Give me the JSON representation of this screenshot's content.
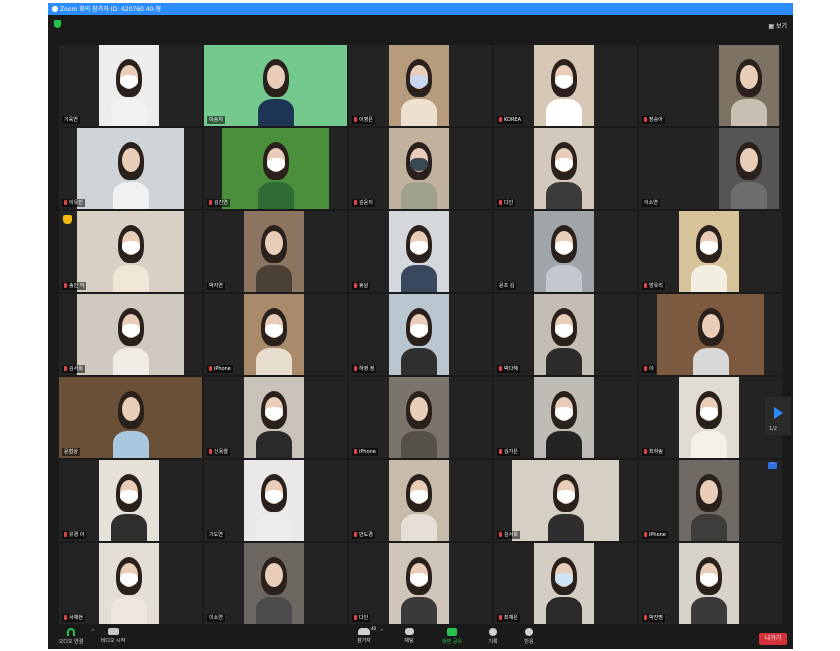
{
  "window": {
    "title": "Zoom 회의 참가자 ID: 420760   40-형",
    "view_label": "보기"
  },
  "pager": {
    "page": "1/2"
  },
  "participants": [
    {
      "name": "기육연",
      "muted": false,
      "bg": "#ededed",
      "shirt": "#f2f2f2",
      "mask": "#ffffff",
      "hand": false
    },
    {
      "name": "이승지",
      "muted": false,
      "bg": "#74c98e",
      "shirt": "#1e3556",
      "mask": "",
      "hand": false
    },
    {
      "name": "이영은",
      "muted": true,
      "bg": "#b69b7c",
      "shirt": "#ece0d0",
      "mask": "#c8d6ef",
      "hand": false
    },
    {
      "name": "KOREA",
      "muted": true,
      "bg": "#d6c8b5",
      "shirt": "#ffffff",
      "mask": "#ffffff",
      "hand": false
    },
    {
      "name": "장승아",
      "muted": true,
      "bg": "#7d7264",
      "shirt": "#c9c0b3",
      "mask": "",
      "hand": false
    },
    {
      "name": "이유진",
      "muted": true,
      "bg": "#cfd4d8",
      "shirt": "#f1f1f1",
      "mask": "",
      "hand": false
    },
    {
      "name": "김진연",
      "muted": true,
      "bg": "#4a8f3c",
      "shirt": "#2e6b35",
      "mask": "#ffffff",
      "hand": false
    },
    {
      "name": "김윤지",
      "muted": true,
      "bg": "#c0b29d",
      "shirt": "#a0a08f",
      "mask": "#3a4a55",
      "hand": false
    },
    {
      "name": "다인",
      "muted": true,
      "bg": "#d2c8bb",
      "shirt": "#3b3b3b",
      "mask": "#ffffff",
      "hand": false
    },
    {
      "name": "이소연",
      "muted": false,
      "bg": "#555555",
      "shirt": "#6d6d6d",
      "mask": "",
      "hand": false
    },
    {
      "name": "송인 악",
      "muted": true,
      "bg": "#d8d0c4",
      "shirt": "#efe6d6",
      "mask": "#ffffff",
      "hand": true
    },
    {
      "name": "박지연",
      "muted": false,
      "bg": "#8c7560",
      "shirt": "#4a4036",
      "mask": "",
      "hand": false
    },
    {
      "name": "휴날",
      "muted": true,
      "bg": "#d4d8dc",
      "shirt": "#39485e",
      "mask": "#ffffff",
      "hand": false
    },
    {
      "name": "윤조 김",
      "muted": false,
      "bg": "#9fa5a9",
      "shirt": "#c3c8ce",
      "mask": "#ffffff",
      "hand": false
    },
    {
      "name": "방유리",
      "muted": true,
      "bg": "#d6c39a",
      "shirt": "#f3eee2",
      "mask": "#ffffff",
      "hand": false
    },
    {
      "name": "김서희",
      "muted": true,
      "bg": "#cfc9bf",
      "shirt": "#f0ece5",
      "mask": "#ffffff",
      "hand": false
    },
    {
      "name": "iPhone",
      "muted": true,
      "bg": "#a98a6a",
      "shirt": "#e7ddcf",
      "mask": "#ffffff",
      "hand": false
    },
    {
      "name": "하영 정",
      "muted": true,
      "bg": "#b9c6cf",
      "shirt": "#2f2f2f",
      "mask": "#ffffff",
      "hand": false
    },
    {
      "name": "박다혜",
      "muted": true,
      "bg": "#c4bdb3",
      "shirt": "#2b2b2b",
      "mask": "#ffffff",
      "hand": false
    },
    {
      "name": "이",
      "muted": true,
      "bg": "#7b5a3f",
      "shirt": "#d8d8d8",
      "mask": "",
      "hand": false
    },
    {
      "name": "윤협상",
      "muted": false,
      "bg": "#6b5038",
      "shirt": "#a9c8e0",
      "mask": "",
      "hand": false
    },
    {
      "name": "신옥렬",
      "muted": true,
      "bg": "#c9c2b8",
      "shirt": "#2a2a2a",
      "mask": "#ffffff",
      "hand": false
    },
    {
      "name": "iPhone",
      "muted": true,
      "bg": "#7a746b",
      "shirt": "#55504a",
      "mask": "",
      "hand": false
    },
    {
      "name": "김가은",
      "muted": true,
      "bg": "#bfbcb6",
      "shirt": "#232323",
      "mask": "#ffffff",
      "hand": false
    },
    {
      "name": "최하림",
      "muted": true,
      "bg": "#e0dbd3",
      "shirt": "#f5f1ea",
      "mask": "#ffffff",
      "hand": false
    },
    {
      "name": "유경 이",
      "muted": true,
      "bg": "#e6e1d9",
      "shirt": "#2f2f2f",
      "mask": "#ffffff",
      "hand": false
    },
    {
      "name": "기도연",
      "muted": false,
      "bg": "#e9e9e9",
      "shirt": "#ececec",
      "mask": "#ffffff",
      "hand": false
    },
    {
      "name": "안도경",
      "muted": true,
      "bg": "#c8bba9",
      "shirt": "#e5dfd5",
      "mask": "#ffffff",
      "hand": false
    },
    {
      "name": "김서희",
      "muted": true,
      "bg": "#d5cfc4",
      "shirt": "#2e2e2e",
      "mask": "#ffffff",
      "hand": false
    },
    {
      "name": "iPhone",
      "muted": true,
      "bg": "#6f6a63",
      "shirt": "#3c3c3c",
      "mask": "",
      "hand": false
    },
    {
      "name": "서채현",
      "muted": true,
      "bg": "#e4dfd6",
      "shirt": "#ede7de",
      "mask": "#ffffff",
      "hand": false
    },
    {
      "name": "이소연",
      "muted": false,
      "bg": "#6c6760",
      "shirt": "#4b4b4b",
      "mask": "",
      "hand": false
    },
    {
      "name": "다인",
      "muted": true,
      "bg": "#cfc6b9",
      "shirt": "#3a3a3a",
      "mask": "#ffffff",
      "hand": false
    },
    {
      "name": "최재은",
      "muted": true,
      "bg": "#d3cdc4",
      "shirt": "#2a2a2a",
      "mask": "#cfe3f7",
      "hand": false
    },
    {
      "name": "박진명",
      "muted": true,
      "bg": "#d7d2ca",
      "shirt": "#3a3a3a",
      "mask": "#ffffff",
      "hand": false
    }
  ],
  "toolbar": {
    "audio_label": "오디오 연결",
    "video_label": "비디오 시작",
    "participants_label": "참가자",
    "participants_count": "40",
    "chat_label": "채팅",
    "share_label": "화면 공유",
    "record_label": "기록",
    "reactions_label": "반응",
    "leave_label": "나가기"
  },
  "colors": {
    "accent": "#2d8cff",
    "share_green": "#27c24c",
    "leave_red": "#d4323a",
    "mute_red": "#e04545"
  }
}
